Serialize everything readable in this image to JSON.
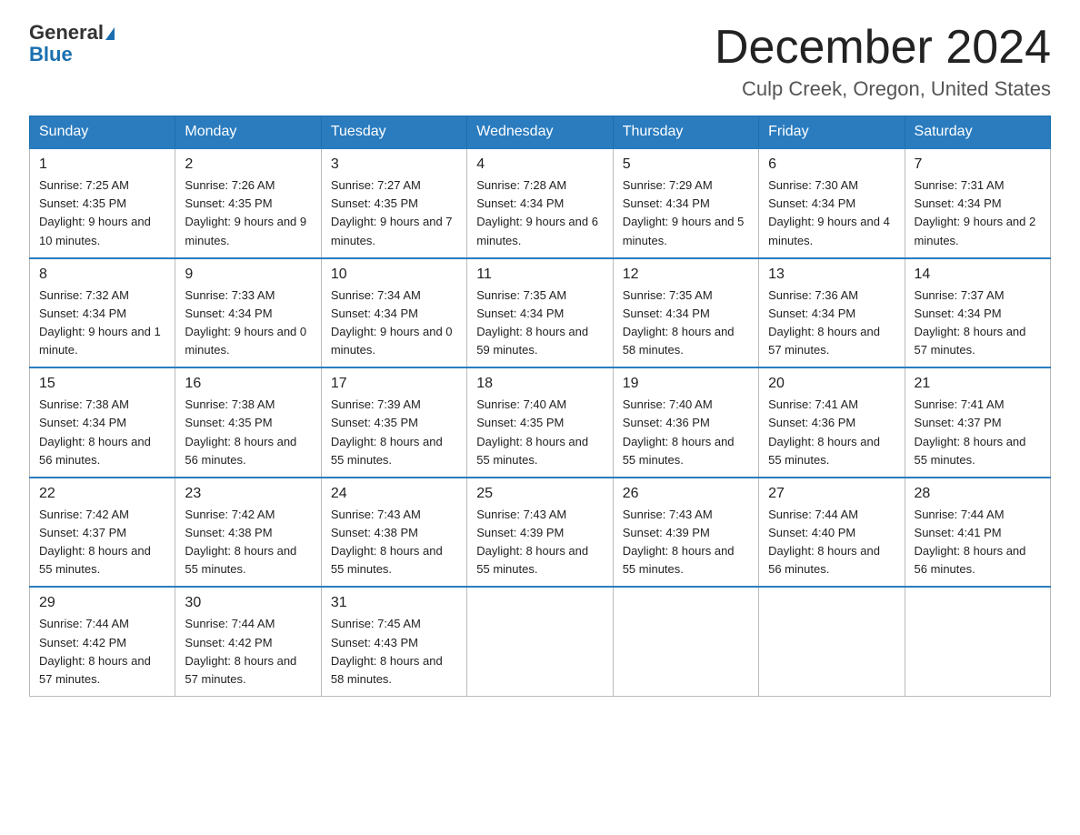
{
  "header": {
    "logo_general": "General",
    "logo_blue": "Blue",
    "month_year": "December 2024",
    "location": "Culp Creek, Oregon, United States"
  },
  "days_of_week": [
    "Sunday",
    "Monday",
    "Tuesday",
    "Wednesday",
    "Thursday",
    "Friday",
    "Saturday"
  ],
  "weeks": [
    [
      {
        "day": "1",
        "sunrise": "7:25 AM",
        "sunset": "4:35 PM",
        "daylight": "9 hours and 10 minutes."
      },
      {
        "day": "2",
        "sunrise": "7:26 AM",
        "sunset": "4:35 PM",
        "daylight": "9 hours and 9 minutes."
      },
      {
        "day": "3",
        "sunrise": "7:27 AM",
        "sunset": "4:35 PM",
        "daylight": "9 hours and 7 minutes."
      },
      {
        "day": "4",
        "sunrise": "7:28 AM",
        "sunset": "4:34 PM",
        "daylight": "9 hours and 6 minutes."
      },
      {
        "day": "5",
        "sunrise": "7:29 AM",
        "sunset": "4:34 PM",
        "daylight": "9 hours and 5 minutes."
      },
      {
        "day": "6",
        "sunrise": "7:30 AM",
        "sunset": "4:34 PM",
        "daylight": "9 hours and 4 minutes."
      },
      {
        "day": "7",
        "sunrise": "7:31 AM",
        "sunset": "4:34 PM",
        "daylight": "9 hours and 2 minutes."
      }
    ],
    [
      {
        "day": "8",
        "sunrise": "7:32 AM",
        "sunset": "4:34 PM",
        "daylight": "9 hours and 1 minute."
      },
      {
        "day": "9",
        "sunrise": "7:33 AM",
        "sunset": "4:34 PM",
        "daylight": "9 hours and 0 minutes."
      },
      {
        "day": "10",
        "sunrise": "7:34 AM",
        "sunset": "4:34 PM",
        "daylight": "9 hours and 0 minutes."
      },
      {
        "day": "11",
        "sunrise": "7:35 AM",
        "sunset": "4:34 PM",
        "daylight": "8 hours and 59 minutes."
      },
      {
        "day": "12",
        "sunrise": "7:35 AM",
        "sunset": "4:34 PM",
        "daylight": "8 hours and 58 minutes."
      },
      {
        "day": "13",
        "sunrise": "7:36 AM",
        "sunset": "4:34 PM",
        "daylight": "8 hours and 57 minutes."
      },
      {
        "day": "14",
        "sunrise": "7:37 AM",
        "sunset": "4:34 PM",
        "daylight": "8 hours and 57 minutes."
      }
    ],
    [
      {
        "day": "15",
        "sunrise": "7:38 AM",
        "sunset": "4:34 PM",
        "daylight": "8 hours and 56 minutes."
      },
      {
        "day": "16",
        "sunrise": "7:38 AM",
        "sunset": "4:35 PM",
        "daylight": "8 hours and 56 minutes."
      },
      {
        "day": "17",
        "sunrise": "7:39 AM",
        "sunset": "4:35 PM",
        "daylight": "8 hours and 55 minutes."
      },
      {
        "day": "18",
        "sunrise": "7:40 AM",
        "sunset": "4:35 PM",
        "daylight": "8 hours and 55 minutes."
      },
      {
        "day": "19",
        "sunrise": "7:40 AM",
        "sunset": "4:36 PM",
        "daylight": "8 hours and 55 minutes."
      },
      {
        "day": "20",
        "sunrise": "7:41 AM",
        "sunset": "4:36 PM",
        "daylight": "8 hours and 55 minutes."
      },
      {
        "day": "21",
        "sunrise": "7:41 AM",
        "sunset": "4:37 PM",
        "daylight": "8 hours and 55 minutes."
      }
    ],
    [
      {
        "day": "22",
        "sunrise": "7:42 AM",
        "sunset": "4:37 PM",
        "daylight": "8 hours and 55 minutes."
      },
      {
        "day": "23",
        "sunrise": "7:42 AM",
        "sunset": "4:38 PM",
        "daylight": "8 hours and 55 minutes."
      },
      {
        "day": "24",
        "sunrise": "7:43 AM",
        "sunset": "4:38 PM",
        "daylight": "8 hours and 55 minutes."
      },
      {
        "day": "25",
        "sunrise": "7:43 AM",
        "sunset": "4:39 PM",
        "daylight": "8 hours and 55 minutes."
      },
      {
        "day": "26",
        "sunrise": "7:43 AM",
        "sunset": "4:39 PM",
        "daylight": "8 hours and 55 minutes."
      },
      {
        "day": "27",
        "sunrise": "7:44 AM",
        "sunset": "4:40 PM",
        "daylight": "8 hours and 56 minutes."
      },
      {
        "day": "28",
        "sunrise": "7:44 AM",
        "sunset": "4:41 PM",
        "daylight": "8 hours and 56 minutes."
      }
    ],
    [
      {
        "day": "29",
        "sunrise": "7:44 AM",
        "sunset": "4:42 PM",
        "daylight": "8 hours and 57 minutes."
      },
      {
        "day": "30",
        "sunrise": "7:44 AM",
        "sunset": "4:42 PM",
        "daylight": "8 hours and 57 minutes."
      },
      {
        "day": "31",
        "sunrise": "7:45 AM",
        "sunset": "4:43 PM",
        "daylight": "8 hours and 58 minutes."
      },
      null,
      null,
      null,
      null
    ]
  ]
}
